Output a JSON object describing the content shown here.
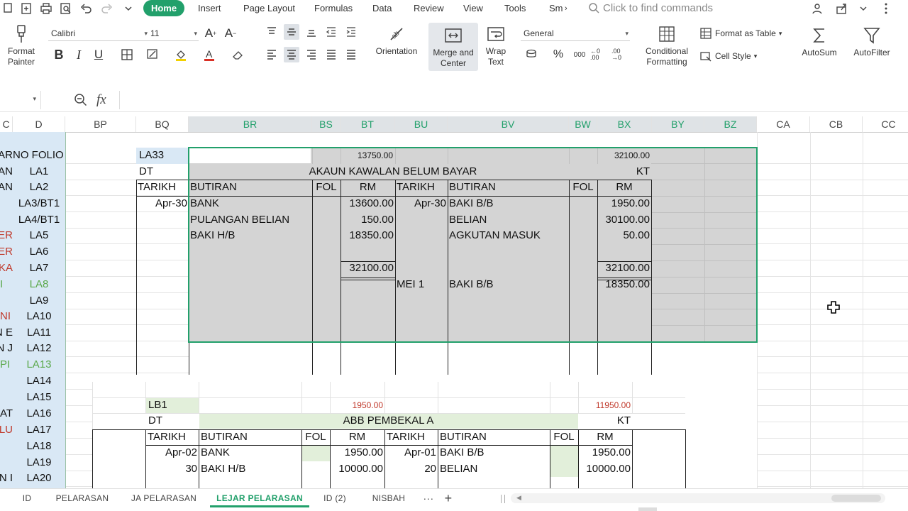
{
  "toolbar": {
    "tabs": [
      "Home",
      "Insert",
      "Page Layout",
      "Formulas",
      "Data",
      "Review",
      "View",
      "Tools",
      "Sm"
    ],
    "search_placeholder": "Click to find commands"
  },
  "ribbon": {
    "format_painter": [
      "Format",
      "Painter"
    ],
    "font_name": "Calibri",
    "font_size": "11",
    "orientation": "Orientation",
    "merge_center": [
      "Merge and",
      "Center"
    ],
    "wrap_text": [
      "Wrap",
      "Text"
    ],
    "number_format": "General",
    "conditional_formatting": [
      "Conditional",
      "Formatting"
    ],
    "format_as_table": "Format as Table",
    "cell_style": "Cell Style",
    "autosum": "AutoSum",
    "autofilter": "AutoFilter",
    "percent": "%",
    "thousands": "000",
    "inc_decimal": "←0 .00",
    "dec_decimal": ".00 →0"
  },
  "formula_bar": {
    "name_box": "",
    "fx": "fx",
    "formula": ""
  },
  "columns": {
    "left": [
      "C",
      "D",
      "BP",
      "BQ"
    ],
    "selected": [
      "BR",
      "BS",
      "BT",
      "BU",
      "BV",
      "BW",
      "BX",
      "BY",
      "BZ"
    ],
    "right": [
      "CA",
      "CB",
      "CC"
    ]
  },
  "col_c_fragments": [
    "AR",
    "AN",
    "AN",
    "",
    "",
    "ER",
    "ER",
    "KA",
    "I",
    "",
    "NI",
    "N E",
    "N J",
    "PI",
    "",
    "",
    "AT",
    "ELU",
    "",
    "",
    "N I"
  ],
  "col_d": {
    "header": "NO FOLIO",
    "items": [
      "LA1",
      "LA2",
      "LA3/BT1",
      "LA4/BT1",
      "LA5",
      "LA6",
      "LA7",
      "LA8",
      "LA9",
      "LA10",
      "LA11",
      "LA12",
      "LA13",
      "LA14",
      "LA15",
      "LA16",
      "LA17",
      "LA18",
      "LA19",
      "LA20"
    ]
  },
  "ledger1": {
    "folio": "LA33",
    "dt": "DT",
    "kt": "KT",
    "debit_total_note": "13750.00",
    "credit_total_note": "32100.00",
    "title": "AKAUN KAWALAN BELUM BAYAR",
    "headers": [
      "TARIKH",
      "BUTIRAN",
      "FOL",
      "RM",
      "TARIKH",
      "BUTIRAN",
      "FOL",
      "RM"
    ],
    "debit_rows": [
      {
        "date": "Apr-30",
        "desc": "BANK",
        "amount": "13600.00"
      },
      {
        "date": "",
        "desc": "PULANGAN BELIAN",
        "amount": "150.00"
      },
      {
        "date": "",
        "desc": "BAKI H/B",
        "amount": "18350.00"
      }
    ],
    "credit_rows": [
      {
        "date": "Apr-30",
        "desc": "BAKI B/B",
        "amount": "1950.00"
      },
      {
        "date": "",
        "desc": "BELIAN",
        "amount": "30100.00"
      },
      {
        "date": "",
        "desc": "AGKUTAN MASUK",
        "amount": "50.00"
      }
    ],
    "debit_total": "32100.00",
    "credit_total": "32100.00",
    "carry_date": "MEI 1",
    "carry_desc": "BAKI B/B",
    "carry_amount": "18350.00"
  },
  "ledger2": {
    "folio": "LB1",
    "dt": "DT",
    "kt": "KT",
    "debit_total_note": "1950.00",
    "credit_total_note": "11950.00",
    "title": "ABB PEMBEKAL A",
    "headers": [
      "TARIKH",
      "BUTIRAN",
      "FOL",
      "RM",
      "TARIKH",
      "BUTIRAN",
      "FOL",
      "RM"
    ],
    "debit_rows": [
      {
        "date": "Apr-02",
        "desc": "BANK",
        "amount": "1950.00"
      },
      {
        "date": "30",
        "desc": "BAKI H/B",
        "amount": "10000.00"
      }
    ],
    "credit_rows": [
      {
        "date": "Apr-01",
        "desc": "BAKI B/B",
        "amount": "1950.00"
      },
      {
        "date": "20",
        "desc": "BELIAN",
        "amount": "10000.00"
      }
    ]
  },
  "sheets": {
    "tabs": [
      "ID",
      "PELARASAN",
      "JA PELARASAN",
      "LEJAR PELARASAN",
      "ID (2)",
      "NISBAH"
    ],
    "active": "LEJAR PELARASAN",
    "more": "···",
    "add": "+"
  },
  "colors": {
    "accent": "#22a06b",
    "selection_fill": "#d4d4d4",
    "light_green": "#e2efda",
    "header_blue": "#d9e8f5",
    "red_text": "#c0392b"
  }
}
